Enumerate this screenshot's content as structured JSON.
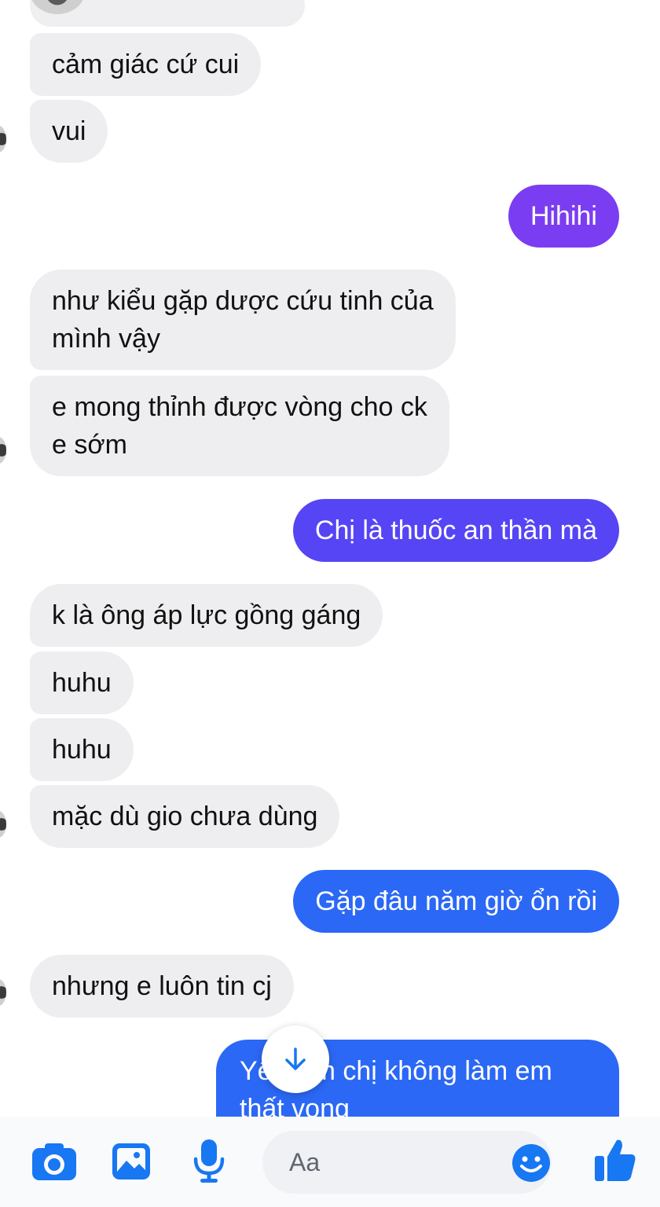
{
  "messages": [
    {
      "side": "in",
      "text": "cảm giác cứ cui"
    },
    {
      "side": "in",
      "text": "vui"
    },
    {
      "side": "out",
      "text": "Hihihi"
    },
    {
      "side": "in",
      "lines": [
        "như kiểu gặp dược cứu tinh của",
        "mình vậy"
      ]
    },
    {
      "side": "in",
      "lines": [
        "e mong thỉnh được vòng cho ck",
        "e sớm"
      ]
    },
    {
      "side": "out",
      "text": "Chị là thuốc an thần mà"
    },
    {
      "side": "in",
      "text": "k là ông áp lực gồng gáng"
    },
    {
      "side": "in",
      "text": "huhu"
    },
    {
      "side": "in",
      "text": "huhu"
    },
    {
      "side": "in",
      "text": "mặc dù gio chưa dùng"
    },
    {
      "side": "out",
      "text": "Gặp đâu năm giờ ổn rồi"
    },
    {
      "side": "in",
      "text": "nhưng e luôn tin cj"
    },
    {
      "side": "out",
      "lines": [
        "Yê",
        "m chị không làm em",
        "thất vọng"
      ]
    }
  ],
  "composer": {
    "placeholder": "Aa",
    "icons": [
      "camera-icon",
      "gallery-icon",
      "microphone-icon",
      "emoji-icon",
      "thumbs-up-icon"
    ]
  },
  "scroll_to_bottom_icon": "arrow-down-icon",
  "colors": {
    "incoming_bubble": "#eeeef0",
    "outgoing_purple": "#7b3df2",
    "outgoing_indigo": "#5645f4",
    "outgoing_blue": "#2b68f5",
    "accent": "#1877f2"
  }
}
